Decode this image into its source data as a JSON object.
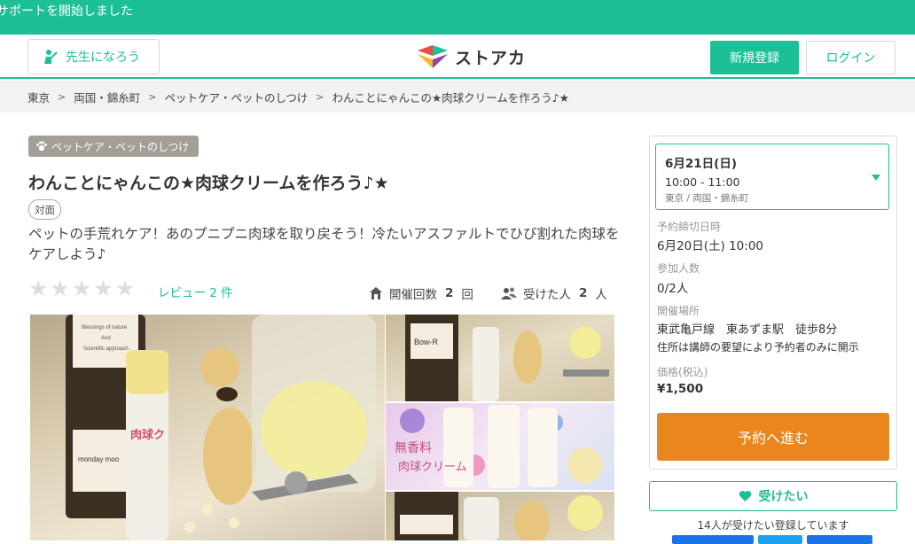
{
  "banner": {
    "text": "サポートを開始しました"
  },
  "header": {
    "teacher_label": "先生になろう",
    "logo_text": "ストアカ",
    "signup_label": "新規登録",
    "login_label": "ログイン"
  },
  "breadcrumb": [
    "東京",
    "両国・錦糸町",
    "ペットケア・ペットのしつけ",
    "わんことにゃんこの★肉球クリームを作ろう♪★"
  ],
  "course": {
    "category": "ペットケア・ペットのしつけ",
    "title": "わんことにゃんこの★肉球クリームを作ろう♪★",
    "format_tag": "対面",
    "description": "ペットの手荒れケア！あのプニプニ肉球を取り戻そう！冷たいアスファルトでひび割れた肉球をケアしよう♪",
    "rating_stars": 0,
    "review_link": "レビュー 2 件",
    "held_label": "開催回数",
    "held_count": "2",
    "held_unit": "回",
    "attended_label": "受けた人",
    "attended_count": "2",
    "attended_unit": "人"
  },
  "photos": {
    "main_label_1": "Blessings of nature",
    "main_label_2": "And",
    "main_label_3": "Scientific approach",
    "main_brand": "monday moo",
    "tube_text": "肉球ク",
    "side_2_text_1": "無香料",
    "side_2_text_2": "肉球クリーム",
    "side_1_text": "Bow-R"
  },
  "sidebar": {
    "date": "6月21日(日)",
    "time": "10:00 - 11:00",
    "area": "東京 / 両国・錦糸町",
    "deadline_label": "予約締切日時",
    "deadline_value": "6月20日(土) 10:00",
    "participants_label": "参加人数",
    "participants_value": "0/2人",
    "venue_label": "開催場所",
    "venue_value": "東武亀戸線　東あずま駅　徒歩8分",
    "venue_note": "住所は講師の要望により予約者のみに開示",
    "price_label": "価格(税込)",
    "price_value": "¥1,500",
    "reserve_label": "予約へ進む",
    "want_label": "受けたい",
    "want_count_text": "14人が受けたい登録しています"
  },
  "colors": {
    "brand": "#1dbf96",
    "reserve": "#ea861e",
    "category": "#a39e96"
  }
}
